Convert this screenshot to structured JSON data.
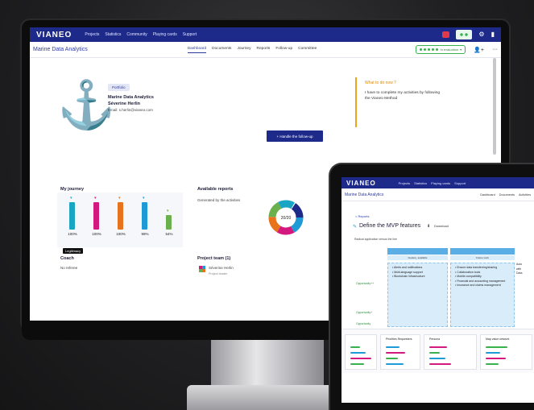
{
  "monitor": {
    "nav": {
      "logo": "VIANEO",
      "links": [
        "Projects",
        "Statistics",
        "Community",
        "Playing cards",
        "Support"
      ]
    },
    "subnav": {
      "project_title": "Marine Data Analytics",
      "tabs": [
        "Dashboard",
        "Documents",
        "Journey",
        "Reports",
        "Follow-up",
        "Committee"
      ],
      "active_tab": "Dashboard",
      "status_label": "In evaluation"
    },
    "profile": {
      "badge": "Portfolio",
      "company": "Marine Data Analytics",
      "person": "Séverine Herlin",
      "email_label": "Email:",
      "email": "s.herlin@vianeo.com"
    },
    "notice": {
      "title": "What to do now ?",
      "text": "I have to complete my activities by following the Vianeo Method"
    },
    "followup_button": "+ Handle the follow-up",
    "journey": {
      "title": "My journey",
      "bars": [
        {
          "pct": "100%",
          "color": "#19a5c4",
          "fill": 1.0
        },
        {
          "pct": "100%",
          "color": "#d4197e",
          "fill": 1.0
        },
        {
          "pct": "100%",
          "color": "#e8731c",
          "fill": 1.0
        },
        {
          "pct": "99%",
          "color": "#1e9bd7",
          "fill": 0.99
        },
        {
          "pct": "54%",
          "color": "#6ab04c",
          "fill": 0.54
        }
      ],
      "tooltip": "Legitimacy"
    },
    "reports": {
      "title": "Available reports",
      "subtitle": "Generated by the activities",
      "donut_label": "20/20"
    },
    "coach": {
      "title": "Coach",
      "value": "No referee"
    },
    "team": {
      "title": "Project team (1)",
      "member_name": "Séverine Herlin",
      "member_role": "Project leader"
    }
  },
  "tablet": {
    "nav": {
      "logo": "VIANEO",
      "links": [
        "Projects",
        "Statistics",
        "Playing cards",
        "Support"
      ]
    },
    "subnav": {
      "project_title": "Marine Data Analytics",
      "tabs": [
        "Dashboard",
        "Documents",
        "Activities"
      ]
    },
    "crumb": "< Reports",
    "heading": "Define the MVP features",
    "download": "Download",
    "caption": "Radical application versus the line",
    "columns": [
      "",
      ""
    ],
    "subcolumns": [
      "Feature, available",
      "Future work"
    ],
    "cells": [
      [
        "Alerts and notifications",
        "Multi-language support",
        "Blockchain infrastructure"
      ],
      [
        "Ensure data transferring/sharing",
        "Collaboration tools",
        "Mobile compatibility",
        "Financial and accounting management",
        "Insurance and claims management"
      ],
      [
        "Auto",
        "with",
        "Data"
      ]
    ],
    "row_labels": [
      "Opportunity++",
      "Opportunity+",
      "Opportunity"
    ],
    "panels": [
      "Priorities Requesters",
      "Persona",
      "Map value network"
    ]
  }
}
